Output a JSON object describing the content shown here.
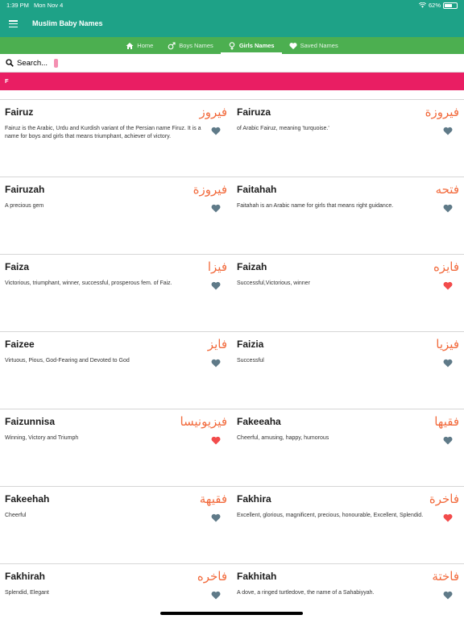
{
  "status_bar": {
    "time": "1:39 PM",
    "date": "Mon Nov 4",
    "battery": "62%",
    "battery_level": 0.62
  },
  "app": {
    "title": "Muslim Baby Names",
    "accent": "#1ea287"
  },
  "tabs": [
    {
      "label": "Home",
      "icon": "home-icon"
    },
    {
      "label": "Boys Names",
      "icon": "male-icon"
    },
    {
      "label": "Girls Names",
      "icon": "female-icon",
      "active": true
    },
    {
      "label": "Saved Names",
      "icon": "heart-icon"
    }
  ],
  "search": {
    "placeholder": "Search..."
  },
  "section": {
    "letter": "F"
  },
  "names": [
    {
      "en": "Fairuz",
      "ar": "فيروز",
      "meaning": "Fairuz is the Arabic, Urdu and Kurdish variant of the Persian name Firuz. It is a name for boys and girls that means triumphant, achiever of victory.",
      "saved": false
    },
    {
      "en": "Fairuza",
      "ar": "فيروزة",
      "meaning": "of Arabic Fairuz, meaning 'turquoise.'",
      "saved": false
    },
    {
      "en": "Fairuzah",
      "ar": "فيروزة",
      "meaning": "A precious gem",
      "saved": false
    },
    {
      "en": "Faitahah",
      "ar": "فتحه",
      "meaning": "Faitahah is an Arabic name for girls that means right guidance.",
      "saved": false
    },
    {
      "en": "Faiza",
      "ar": "فيزا",
      "meaning": "Victorious, triumphant, winner, successful, prosperous fem. of Faiz.",
      "saved": false
    },
    {
      "en": "Faizah",
      "ar": "فايزه",
      "meaning": "Successful,Victorious, winner",
      "saved": true
    },
    {
      "en": "Faizee",
      "ar": "فايز",
      "meaning": "Virtuous, Pious, God-Fearing and Devoted to God",
      "saved": false
    },
    {
      "en": "Faizia",
      "ar": "فيزيا",
      "meaning": "Successful",
      "saved": false
    },
    {
      "en": "Faizunnisa",
      "ar": "فيزيونيسا",
      "meaning": "Winning, Victory and Triumph",
      "saved": true
    },
    {
      "en": "Fakeeaha",
      "ar": "فقيها",
      "meaning": "Cheerful, amusing, happy, humorous",
      "saved": false
    },
    {
      "en": "Fakeehah",
      "ar": "فقيهة",
      "meaning": "Cheerful",
      "saved": false
    },
    {
      "en": "Fakhira",
      "ar": "فاخرة",
      "meaning": "Excellent, glorious, magnificent, precious, honourable, Excellent, Splendid.",
      "saved": true
    },
    {
      "en": "Fakhirah",
      "ar": "فاخره",
      "meaning": "Splendid, Elegant",
      "saved": false
    },
    {
      "en": "Fakhitah",
      "ar": "فاختة",
      "meaning": "A dove, a ringed turtledove, the name of a Sahabiyyah.",
      "saved": false
    }
  ],
  "colors": {
    "heart_saved": "#f24b4b",
    "heart_unsaved": "#5f7a88",
    "arabic_text": "#f26a3c",
    "section_bar": "#e91e63",
    "tab_bar": "#4caf50"
  }
}
